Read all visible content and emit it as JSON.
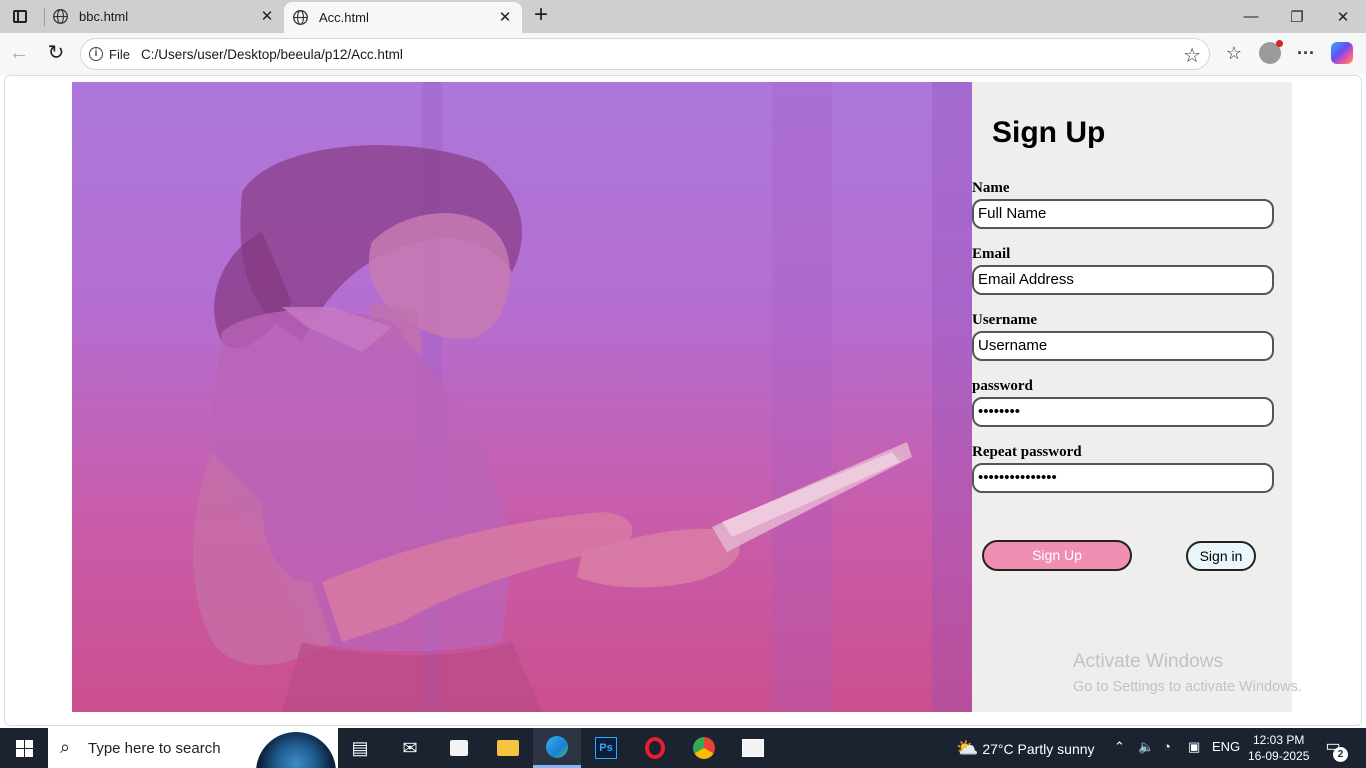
{
  "browser": {
    "tabs": [
      {
        "label": "bbc.html"
      },
      {
        "label": "Acc.html"
      }
    ],
    "address": {
      "scheme_label": "File",
      "url": "C:/Users/user/Desktop/beeula/p12/Acc.html"
    }
  },
  "form": {
    "title": "Sign Up",
    "fields": [
      {
        "label": "Name",
        "value": "Full Name"
      },
      {
        "label": "Email",
        "value": "Email Address"
      },
      {
        "label": "Username",
        "value": "Username"
      },
      {
        "label": "password",
        "value": "••••••••"
      },
      {
        "label": "Repeat password",
        "value": "•••••••••••••••"
      }
    ],
    "signup_button": "Sign Up",
    "signin_button": "Sign in"
  },
  "watermark": {
    "line1": "Activate Windows",
    "line2": "Go to Settings to activate Windows."
  },
  "taskbar": {
    "search_placeholder": "Type here to search",
    "weather": "27°C  Partly sunny",
    "language": "ENG",
    "time": "12:03 PM",
    "date": "16-09-2025",
    "notification_count": "2"
  },
  "colors": {
    "signup_button": "#f08fb3",
    "signin_button": "#e9f7fb",
    "panel_background": "#f0eded",
    "hero_overlay_top": "#ad77db",
    "hero_overlay_bottom": "#cb4f8e"
  }
}
